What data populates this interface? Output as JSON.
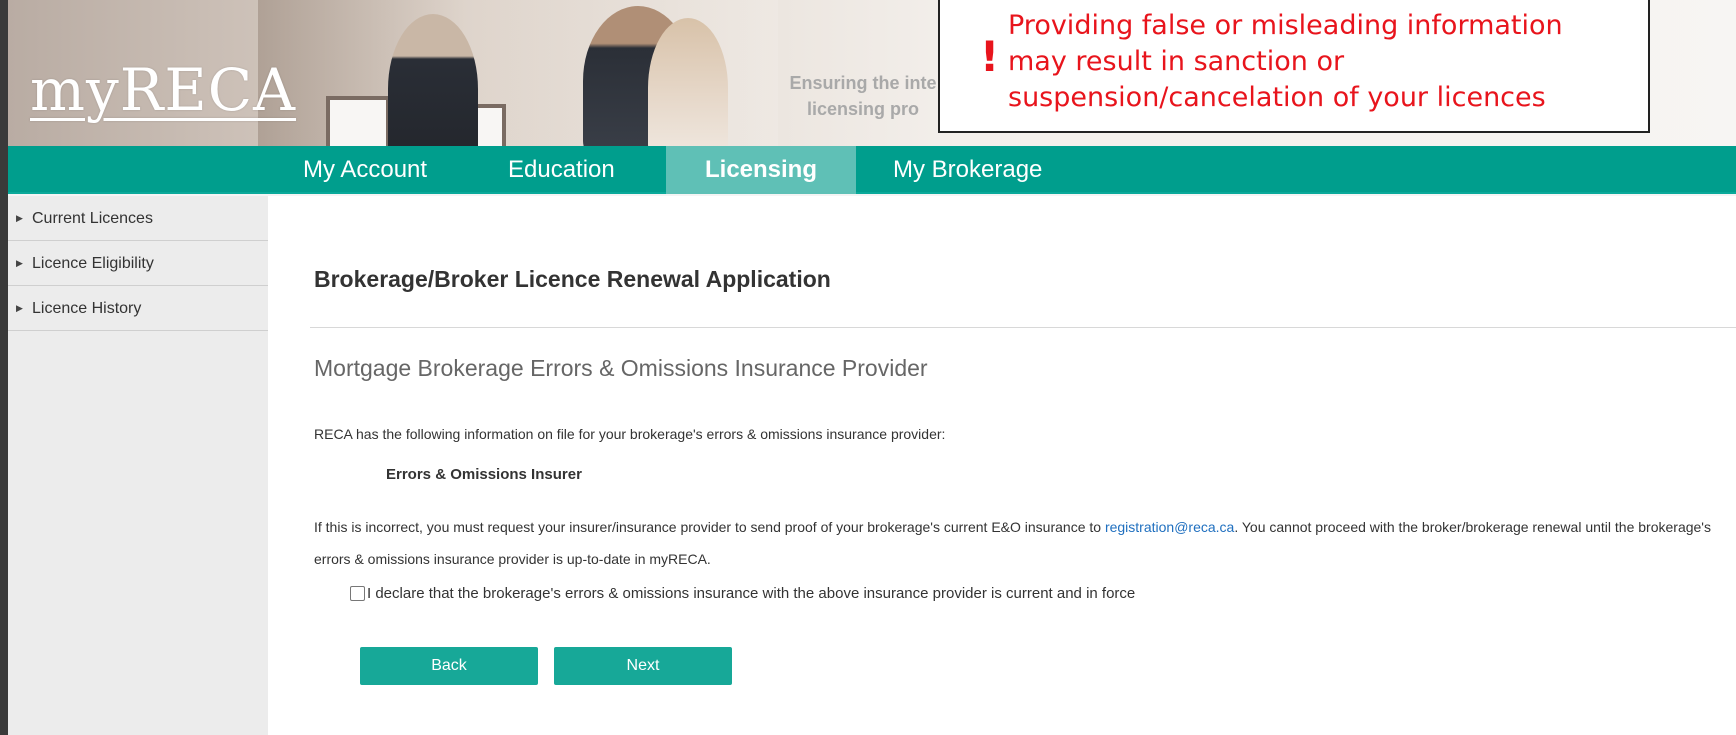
{
  "header": {
    "logo": "myRECA",
    "tagline": "Ensuring the inte licensing pro",
    "tagline_line1": "Ensuring the inte",
    "tagline_line2": "licensing pro"
  },
  "warning": {
    "icon": "!",
    "message": "Providing false or misleading information may result in sanction or suspension/cancelation of your licences"
  },
  "nav": {
    "items": [
      {
        "label": "My Account",
        "active": false
      },
      {
        "label": "Education",
        "active": false
      },
      {
        "label": "Licensing",
        "active": true
      },
      {
        "label": "My Brokerage",
        "active": false
      }
    ]
  },
  "sidebar": {
    "items": [
      {
        "label": "Current Licences"
      },
      {
        "label": "Licence Eligibility"
      },
      {
        "label": "Licence History"
      }
    ]
  },
  "main": {
    "page_title": "Brokerage/Broker Licence Renewal Application",
    "section_title": "Mortgage Brokerage Errors & Omissions Insurance Provider",
    "info_text": "RECA has the following information on file for your brokerage's errors & omissions insurance provider:",
    "insurer_label": "Errors & Omissions Insurer",
    "incorrect_text_before": "If this is incorrect, you must request your insurer/insurance provider to send proof of your brokerage's current E&O insurance to",
    "email": "registration@reca.ca",
    "incorrect_text_after": ". You cannot proceed with the broker/brokerage renewal until the brokerage's errors & omissions insurance provider is up-to-date in myRECA.",
    "declaration": "I declare that the brokerage's errors & omissions insurance with the above insurance provider is current and in force",
    "declaration_checked": false,
    "back_label": "Back",
    "next_label": "Next"
  },
  "colors": {
    "nav_bg": "#009e8d",
    "nav_active": "#5fc0b6",
    "button": "#17a898",
    "warning_text": "#e8141c",
    "link": "#1f6fbf"
  }
}
